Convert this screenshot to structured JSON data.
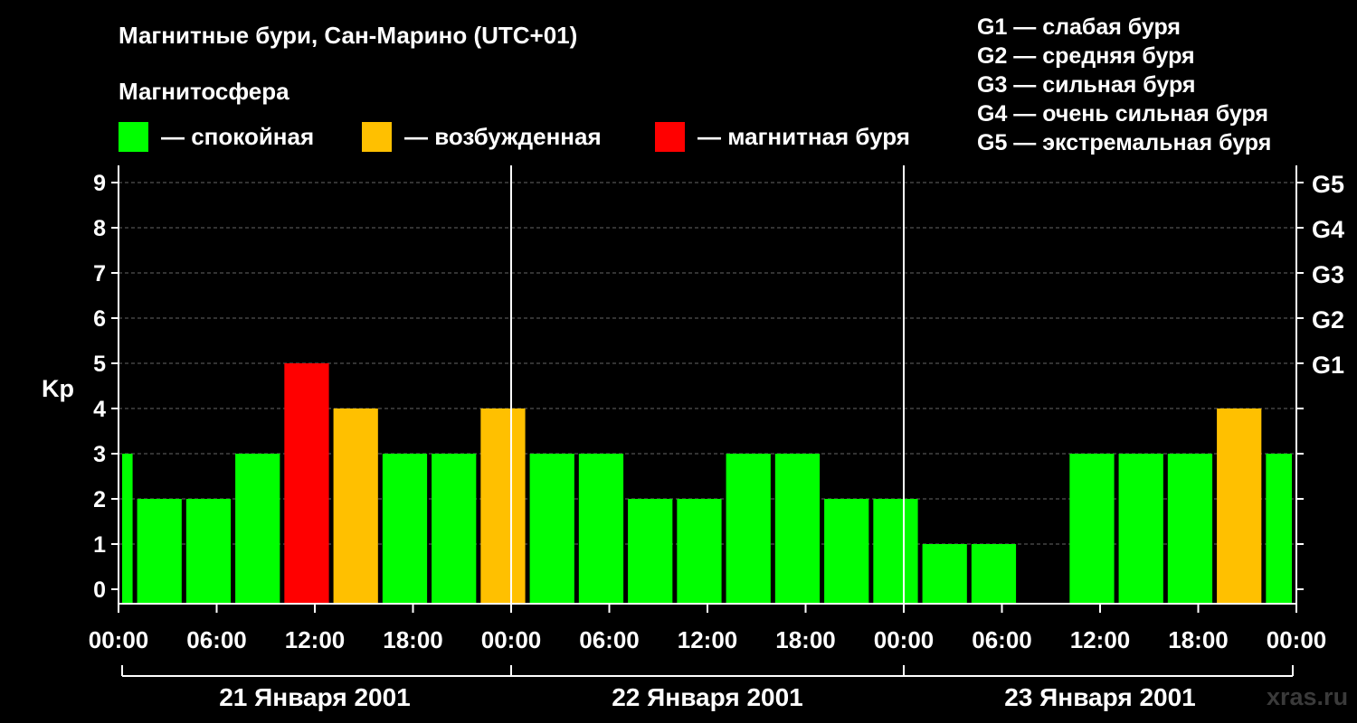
{
  "title": "Магнитные бури, Сан-Марино (UTC+01)",
  "subtitle": "Магнитосфера",
  "legend": [
    {
      "label": "— спокойная",
      "color": "#00ff00"
    },
    {
      "label": "— возбужденная",
      "color": "#ffc000"
    },
    {
      "label": "— магнитная буря",
      "color": "#ff0000"
    }
  ],
  "g_legend": [
    "G1 — слабая буря",
    "G2 — средняя буря",
    "G3 — сильная буря",
    "G4 — очень сильная буря",
    "G5 — экстремальная буря"
  ],
  "watermark": "xras.ru",
  "chart_data": {
    "type": "bar",
    "ylabel": "Kp",
    "ylim": [
      0,
      9
    ],
    "y_ticks": [
      "0",
      "1",
      "2",
      "3",
      "4",
      "5",
      "6",
      "7",
      "8",
      "9"
    ],
    "g_levels": [
      {
        "label": "G1",
        "kp": 5
      },
      {
        "label": "G2",
        "kp": 6
      },
      {
        "label": "G3",
        "kp": 7
      },
      {
        "label": "G4",
        "kp": 8
      },
      {
        "label": "G5",
        "kp": 9
      }
    ],
    "x_ticks": [
      "00:00",
      "06:00",
      "12:00",
      "18:00",
      "00:00",
      "06:00",
      "12:00",
      "18:00",
      "00:00",
      "06:00",
      "12:00",
      "18:00",
      "00:00"
    ],
    "days": [
      "21 Января 2001",
      "22 Января 2001",
      "23 Января 2001"
    ],
    "interval_hours": 3,
    "start_offset_hours": -2,
    "total_hours": 72,
    "values": [
      3,
      2,
      2,
      3,
      5,
      4,
      3,
      3,
      4,
      3,
      3,
      2,
      2,
      3,
      3,
      2,
      2,
      1,
      1,
      0,
      3,
      3,
      3,
      4,
      3
    ],
    "colors": {
      "quiet": "#00ff00",
      "active": "#ffc000",
      "storm": "#ff0000"
    },
    "grid": true
  }
}
